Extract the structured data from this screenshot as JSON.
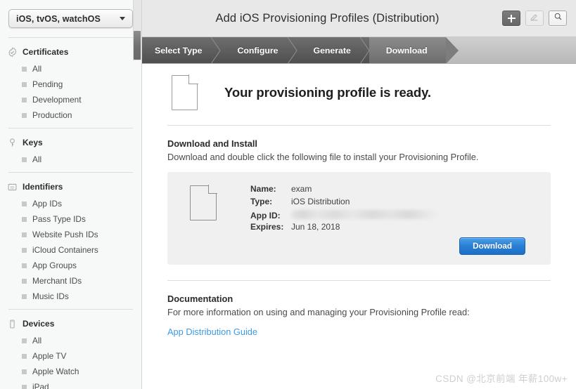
{
  "sidebar": {
    "platform_select": {
      "value": "iOS, tvOS, watchOS",
      "caret_icon": "chevron-down-icon"
    },
    "sections": [
      {
        "title": "Certificates",
        "icon": "certificate-seal-icon",
        "items": [
          "All",
          "Pending",
          "Development",
          "Production"
        ]
      },
      {
        "title": "Keys",
        "icon": "key-icon",
        "items": [
          "All"
        ]
      },
      {
        "title": "Identifiers",
        "icon": "id-badge-icon",
        "items": [
          "App IDs",
          "Pass Type IDs",
          "Website Push IDs",
          "iCloud Containers",
          "App Groups",
          "Merchant IDs",
          "Music IDs"
        ]
      },
      {
        "title": "Devices",
        "icon": "device-icon",
        "items": [
          "All",
          "Apple TV",
          "Apple Watch",
          "iPad"
        ]
      }
    ]
  },
  "header": {
    "title": "Add iOS Provisioning Profiles (Distribution)",
    "buttons": [
      {
        "name": "add-button",
        "icon": "plus-icon",
        "state": "active"
      },
      {
        "name": "edit-button",
        "icon": "pencil-edit-icon",
        "state": "disabled"
      },
      {
        "name": "search-button",
        "icon": "search-icon",
        "state": "normal"
      }
    ]
  },
  "steps": {
    "items": [
      "Select Type",
      "Configure",
      "Generate",
      "Download"
    ],
    "current": "Download"
  },
  "main": {
    "hero": {
      "icon": "document-icon",
      "title": "Your provisioning profile is ready."
    },
    "download_section": {
      "heading": "Download and Install",
      "description": "Download and double click the following file to install your Provisioning Profile."
    },
    "file": {
      "icon": "document-icon",
      "fields": [
        {
          "key": "Name:",
          "value": "exam",
          "redacted": false
        },
        {
          "key": "Type:",
          "value": "iOS Distribution",
          "redacted": false
        },
        {
          "key": "App ID:",
          "value": "",
          "redacted": true
        },
        {
          "key": "Expires:",
          "value": "Jun 18, 2018",
          "redacted": false
        }
      ],
      "download_button": "Download"
    },
    "documentation": {
      "heading": "Documentation",
      "description": "For more information on using and managing your Provisioning Profile read:",
      "link": "App Distribution Guide"
    }
  },
  "watermark": "CSDN @北京前端 年薪100w+",
  "colors": {
    "accent_blue": "#2a7fd4",
    "link_blue": "#3d9ae0",
    "sidebar_bg": "#f7f8f8",
    "topbar_bg": "#e8e8e8",
    "card_bg": "#f0f0f0"
  }
}
